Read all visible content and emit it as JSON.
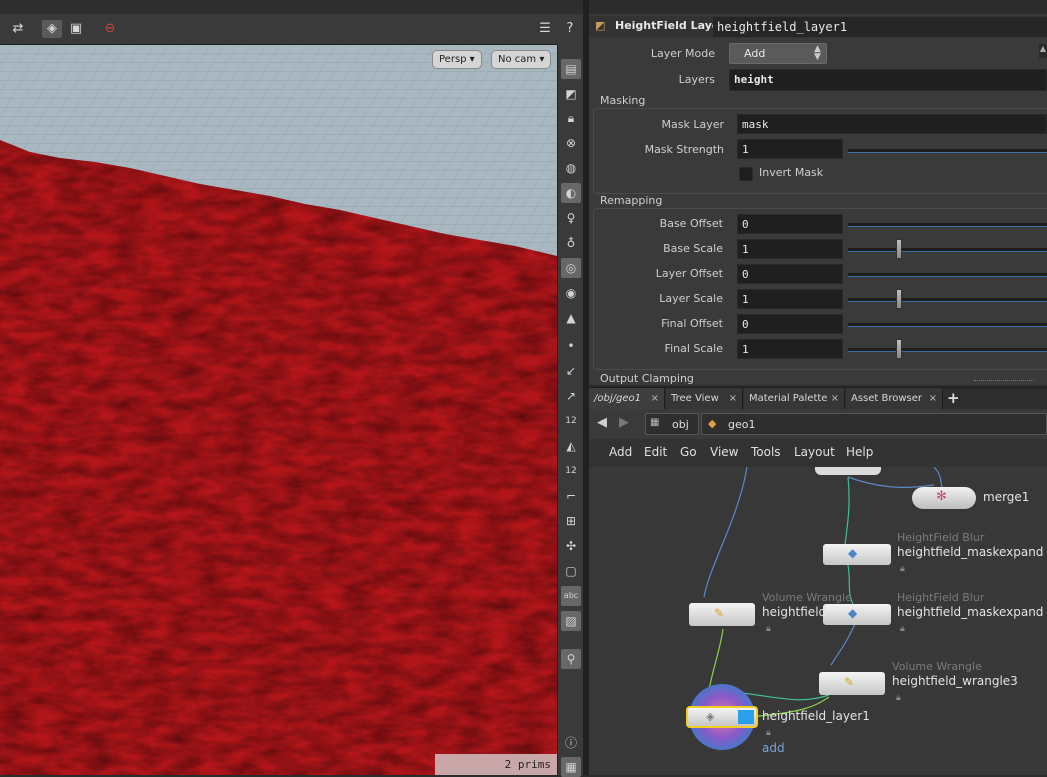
{
  "viewport": {
    "camera_view": "Persp",
    "camera": "No cam",
    "status": "2  prims",
    "side_icons": [
      "view-icon",
      "select-icon",
      "lock-icon",
      "ghost-icon",
      "sphere-icon",
      "light-icon",
      "light-bulb-icon",
      "head-light-icon",
      "snapshot-icon",
      "visibility-icon",
      "render-icon",
      "point-icon",
      "normal-icon",
      "vector-icon",
      "point-numbers-icon",
      "paint-icon",
      "prim-numbers-icon",
      "frame-icon",
      "grid-icon",
      "target-icon",
      "wireframe-icon",
      "abc-icon",
      "image-icon",
      "pin-icon",
      "info-icon",
      "layout-icon"
    ],
    "side_text": {
      "num12a": "12",
      "num12b": "12",
      "abc": "abc"
    }
  },
  "params": {
    "node_type": "HeightField Layer",
    "node_name": "heightfield_layer1",
    "layer_mode_label": "Layer Mode",
    "layer_mode_value": "Add",
    "layers_label": "Layers",
    "layers_value": "height",
    "masking_title": "Masking",
    "mask_layer_label": "Mask Layer",
    "mask_layer_value": "mask",
    "mask_strength_label": "Mask Strength",
    "mask_strength_value": "1",
    "invert_mask_label": "Invert Mask",
    "remapping_title": "Remapping",
    "remap": [
      {
        "label": "Base Offset",
        "value": "0",
        "knob": false
      },
      {
        "label": "Base Scale",
        "value": "1",
        "knob": true
      },
      {
        "label": "Layer Offset",
        "value": "0",
        "knob": false
      },
      {
        "label": "Layer Scale",
        "value": "1",
        "knob": true
      },
      {
        "label": "Final Offset",
        "value": "0",
        "knob": false
      },
      {
        "label": "Final Scale",
        "value": "1",
        "knob": true
      }
    ],
    "output_title": "Output Clamping"
  },
  "network": {
    "tabs": [
      {
        "label": "/obj/geo1"
      },
      {
        "label": "Tree View"
      },
      {
        "label": "Material Palette"
      },
      {
        "label": "Asset Browser"
      }
    ],
    "add_tab": "+",
    "path": [
      "obj",
      "geo1"
    ],
    "menu": [
      "Add",
      "Edit",
      "Go",
      "View",
      "Tools",
      "Layout",
      "Help"
    ],
    "nodes": {
      "merge": {
        "name": "merge1"
      },
      "blur1": {
        "type": "HeightField Blur",
        "name": "heightfield_maskexpand"
      },
      "blur2": {
        "type": "HeightField Blur",
        "name": "heightfield_maskexpand"
      },
      "wrangle_left": {
        "type": "Volume Wrangle",
        "name": "heightfield"
      },
      "wrangle3": {
        "type": "Volume Wrangle",
        "name": "heightfield_wrangle3"
      },
      "layer": {
        "name": "heightfield_layer1",
        "sub": "add"
      }
    }
  }
}
